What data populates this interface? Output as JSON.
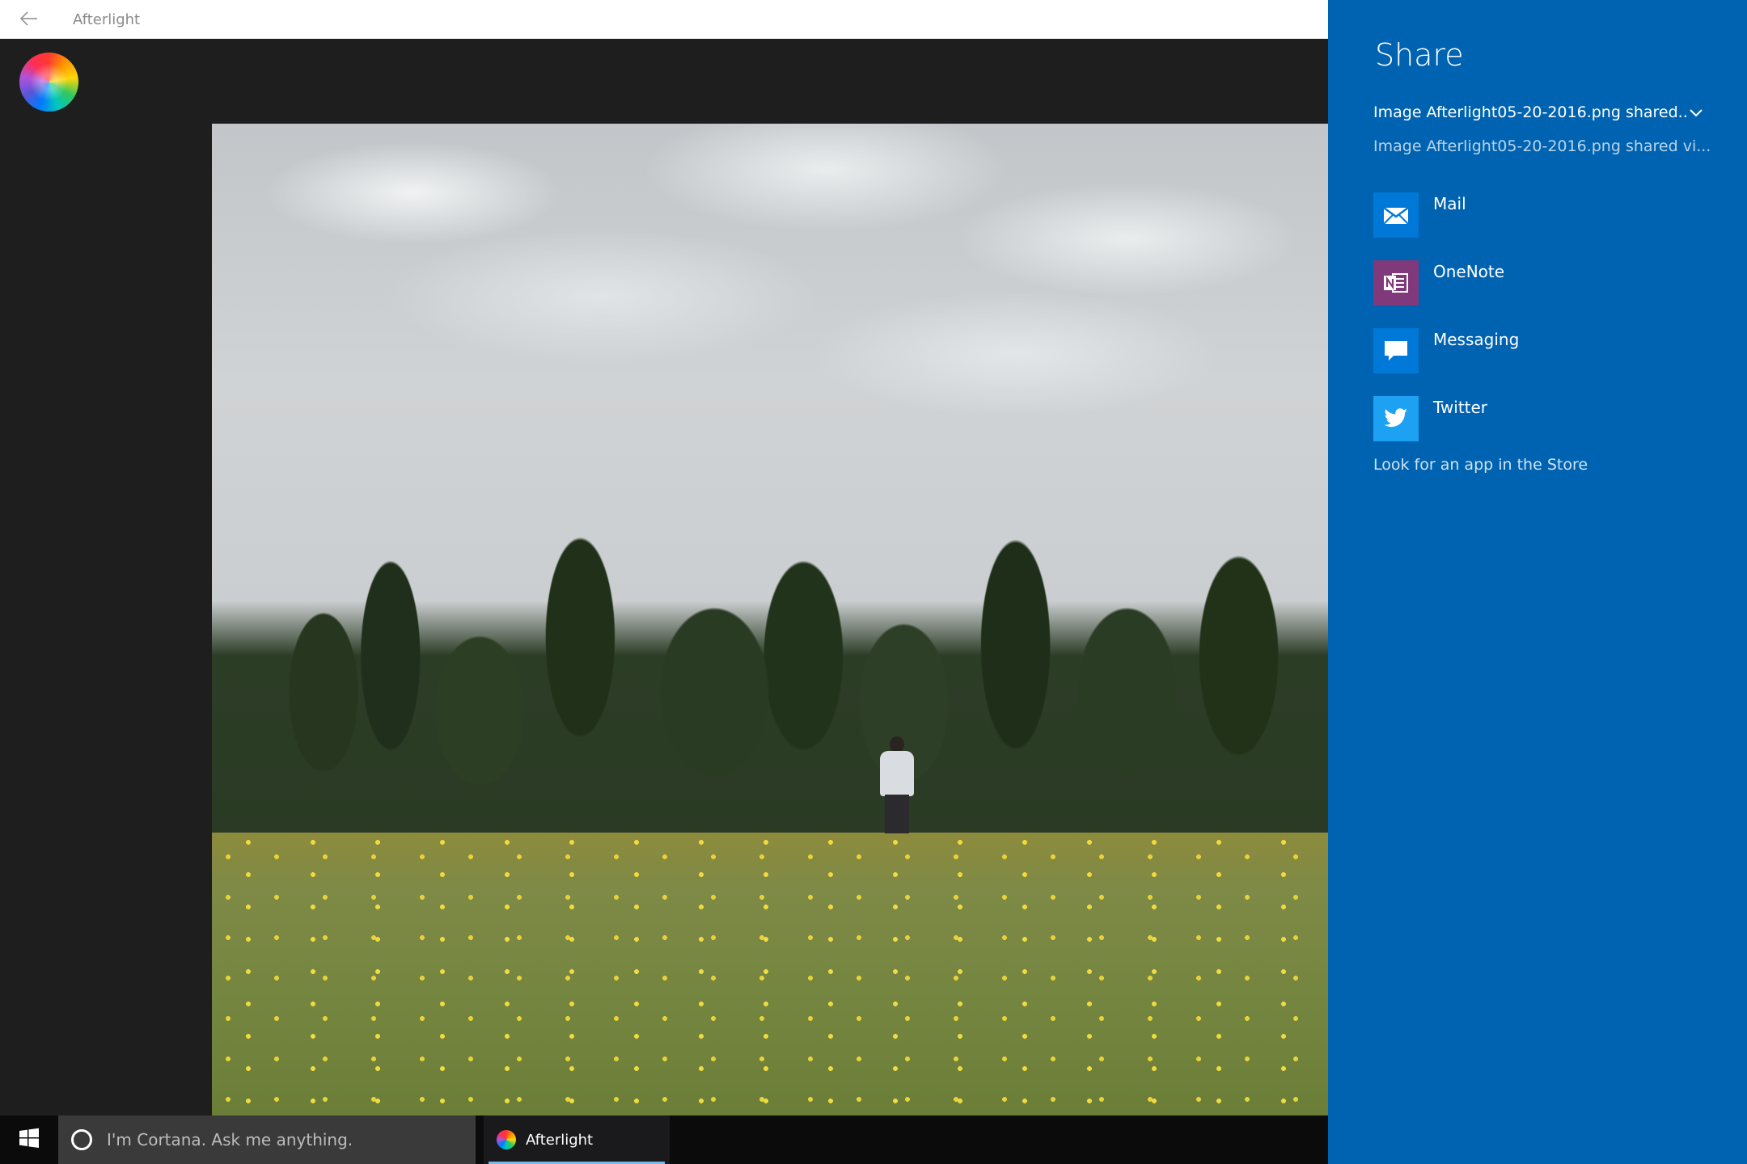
{
  "titlebar": {
    "title": "Afterlight",
    "back_icon": "arrow-left-icon"
  },
  "share_panel": {
    "heading": "Share",
    "selected_item": "Image Afterlight05-20-2016.png shared...",
    "description": "Image Afterlight05-20-2016.png shared vi...",
    "targets": [
      {
        "label": "Mail",
        "icon": "mail-icon",
        "color": "#0078d7"
      },
      {
        "label": "OneNote",
        "icon": "onenote-icon",
        "color": "#80397b"
      },
      {
        "label": "Messaging",
        "icon": "messaging-icon",
        "color": "#0078d7"
      },
      {
        "label": "Twitter",
        "icon": "twitter-icon",
        "color": "#1da1f2"
      }
    ],
    "store_link": "Look for an app in the Store",
    "background_color": "#0063b1"
  },
  "taskbar": {
    "search_placeholder": "I'm Cortana. Ask me anything.",
    "running_app": "Afterlight"
  }
}
